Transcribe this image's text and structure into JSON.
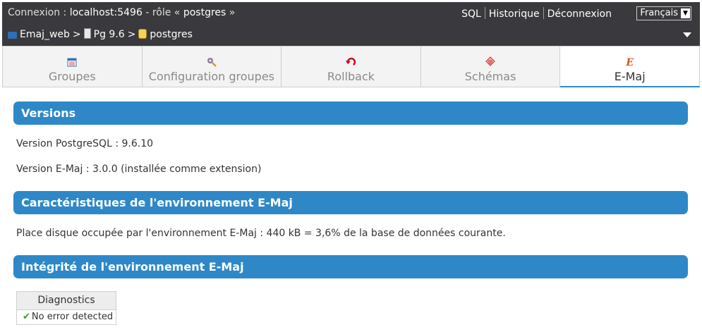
{
  "topbar": {
    "connection_prefix": "Connexion : ",
    "connection_host": "localhost:5496",
    "role_prefix": " - rôle « ",
    "role_name": "postgres",
    "role_suffix": " »",
    "links": {
      "sql": "SQL",
      "history": "Historique",
      "logout": "Déconnexion"
    },
    "language": "Français"
  },
  "breadcrumb": {
    "server": "Emaj_web",
    "separator": ">",
    "instance": "Pg 9.6",
    "database": "postgres"
  },
  "tabs": [
    {
      "label": "Groupes",
      "icon": "groups-icon"
    },
    {
      "label": "Configuration groupes",
      "icon": "config-groups-icon"
    },
    {
      "label": "Rollback",
      "icon": "rollback-icon"
    },
    {
      "label": "Schémas",
      "icon": "schemas-icon"
    },
    {
      "label": "E-Maj",
      "icon": "emaj-icon",
      "active": true
    }
  ],
  "sections": {
    "versions": {
      "title": "Versions",
      "pg_version": "Version PostgreSQL : 9.6.10",
      "emaj_version": "Version E-Maj : 3.0.0 (installée comme extension)"
    },
    "environment": {
      "title": "Caractéristiques de l'environnement E-Maj",
      "disk_space": "Place disque occupée par l'environnement E-Maj : 440 kB = 3,6% de la base de données courante."
    },
    "integrity": {
      "title": "Intégrité de l'environnement E-Maj",
      "table_header": "Diagnostics",
      "result": "No error detected"
    }
  },
  "colors": {
    "accent": "#2e88c7",
    "topbar": "#3a3a3e",
    "ok": "#3a9b2f"
  }
}
